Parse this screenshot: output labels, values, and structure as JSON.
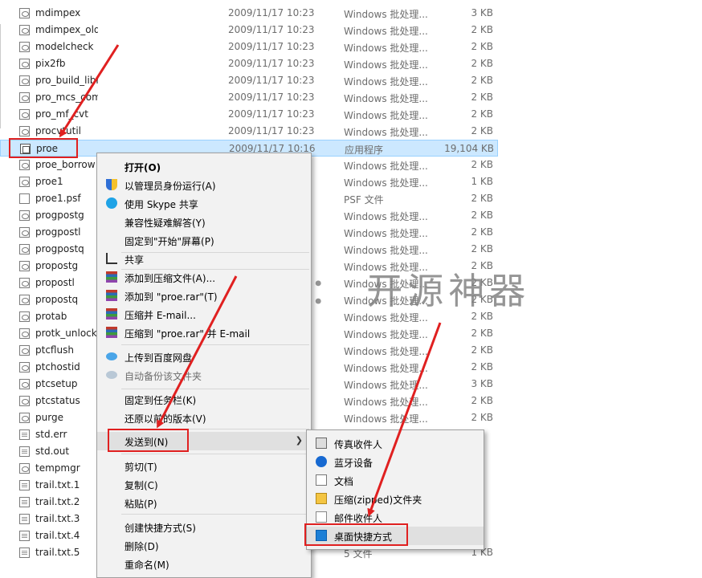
{
  "files": [
    {
      "name": "mdimpex",
      "date": "2009/11/17 10:23",
      "type": "Windows 批处理...",
      "size": "3 KB",
      "icon": "batch-file-icon"
    },
    {
      "name": "mdimpex_old",
      "date": "2009/11/17 10:23",
      "type": "Windows 批处理...",
      "size": "2 KB",
      "icon": "batch-file-icon"
    },
    {
      "name": "modelcheck",
      "date": "2009/11/17 10:23",
      "type": "Windows 批处理...",
      "size": "2 KB",
      "icon": "batch-file-icon"
    },
    {
      "name": "pix2fb",
      "date": "2009/11/17 10:23",
      "type": "Windows 批处理...",
      "size": "2 KB",
      "icon": "batch-file-icon"
    },
    {
      "name": "pro_build_library_ctg",
      "date": "2009/11/17 10:23",
      "type": "Windows 批处理...",
      "size": "2 KB",
      "icon": "batch-file-icon"
    },
    {
      "name": "pro_mcs_comp",
      "date": "2009/11/17 10:23",
      "type": "Windows 批处理...",
      "size": "2 KB",
      "icon": "batch-file-icon"
    },
    {
      "name": "pro_mf_cvt",
      "date": "2009/11/17 10:23",
      "type": "Windows 批处理...",
      "size": "2 KB",
      "icon": "batch-file-icon"
    },
    {
      "name": "procvtutil",
      "date": "2009/11/17 10:23",
      "type": "Windows 批处理...",
      "size": "2 KB",
      "icon": "batch-file-icon"
    },
    {
      "name": "proe",
      "date": "2009/11/17 10:16",
      "type": "应用程序",
      "size": "19,104 KB",
      "icon": "application-icon"
    },
    {
      "name": "proe_borrow",
      "date": "",
      "type": "Windows 批处理...",
      "size": "2 KB",
      "icon": "batch-file-icon"
    },
    {
      "name": "proe1",
      "date": "",
      "type": "Windows 批处理...",
      "size": "1 KB",
      "icon": "batch-file-icon"
    },
    {
      "name": "proe1.psf",
      "date": "",
      "type": "PSF 文件",
      "size": "2 KB",
      "icon": "generic-file-icon"
    },
    {
      "name": "progpostg",
      "date": "",
      "type": "Windows 批处理...",
      "size": "2 KB",
      "icon": "batch-file-icon"
    },
    {
      "name": "progpostl",
      "date": "",
      "type": "Windows 批处理...",
      "size": "2 KB",
      "icon": "batch-file-icon"
    },
    {
      "name": "progpostq",
      "date": "",
      "type": "Windows 批处理...",
      "size": "2 KB",
      "icon": "batch-file-icon"
    },
    {
      "name": "propostg",
      "date": "",
      "type": "Windows 批处理...",
      "size": "2 KB",
      "icon": "batch-file-icon"
    },
    {
      "name": "propostl",
      "date": "",
      "type": "Windows 批处理...",
      "size": "2 KB",
      "icon": "batch-file-icon"
    },
    {
      "name": "propostq",
      "date": "",
      "type": "Windows 批处理...",
      "size": "2 KB",
      "icon": "batch-file-icon"
    },
    {
      "name": "protab",
      "date": "",
      "type": "Windows 批处理...",
      "size": "2 KB",
      "icon": "batch-file-icon"
    },
    {
      "name": "protk_unlock",
      "date": "",
      "type": "Windows 批处理...",
      "size": "2 KB",
      "icon": "batch-file-icon"
    },
    {
      "name": "ptcflush",
      "date": "",
      "type": "Windows 批处理...",
      "size": "2 KB",
      "icon": "batch-file-icon"
    },
    {
      "name": "ptchostid",
      "date": "",
      "type": "Windows 批处理...",
      "size": "2 KB",
      "icon": "batch-file-icon"
    },
    {
      "name": "ptcsetup",
      "date": "",
      "type": "Windows 批处理...",
      "size": "3 KB",
      "icon": "batch-file-icon"
    },
    {
      "name": "ptcstatus",
      "date": "",
      "type": "Windows 批处理...",
      "size": "2 KB",
      "icon": "batch-file-icon"
    },
    {
      "name": "purge",
      "date": "",
      "type": "Windows 批处理...",
      "size": "2 KB",
      "icon": "batch-file-icon"
    },
    {
      "name": "std.err",
      "date": "",
      "type": "",
      "size": "",
      "icon": "text-file-icon"
    },
    {
      "name": "std.out",
      "date": "",
      "type": "",
      "size": "",
      "icon": "text-file-icon"
    },
    {
      "name": "tempmgr",
      "date": "",
      "type": "",
      "size": "",
      "icon": "batch-file-icon"
    },
    {
      "name": "trail.txt.1",
      "date": "",
      "type": "",
      "size": "",
      "icon": "text-file-icon"
    },
    {
      "name": "trail.txt.2",
      "date": "",
      "type": "",
      "size": "",
      "icon": "text-file-icon"
    },
    {
      "name": "trail.txt.3",
      "date": "",
      "type": "",
      "size": "",
      "icon": "text-file-icon"
    },
    {
      "name": "trail.txt.4",
      "date": "",
      "type": "",
      "size": "",
      "icon": "text-file-icon"
    },
    {
      "name": "trail.txt.5",
      "date": "",
      "type": "5 文件",
      "size": "1 KB",
      "icon": "text-file-icon"
    }
  ],
  "selected_file": "proe",
  "context_menu": {
    "open": "打开(O)",
    "run_as_admin": "以管理员身份运行(A)",
    "skype_share": "使用 Skype 共享",
    "compat_troubleshoot": "兼容性疑难解答(Y)",
    "pin_start": "固定到\"开始\"屏幕(P)",
    "share": "共享",
    "add_to_archive": "添加到压缩文件(A)...",
    "add_to_proe_rar": "添加到 \"proe.rar\"(T)",
    "compress_email": "压缩并 E-mail...",
    "compress_proe_rar_email": "压缩到 \"proe.rar\" 并 E-mail",
    "upload_baidu": "上传到百度网盘",
    "auto_backup": "自动备份该文件夹",
    "pin_taskbar": "固定到任务栏(K)",
    "restore_versions": "还原以前的版本(V)",
    "send_to": "发送到(N)",
    "cut": "剪切(T)",
    "copy": "复制(C)",
    "paste": "粘贴(P)",
    "create_shortcut": "创建快捷方式(S)",
    "delete": "删除(D)",
    "rename": "重命名(M)"
  },
  "sendto_menu": {
    "fax": "传真收件人",
    "bluetooth": "蓝牙设备",
    "documents": "文档",
    "zip_folder": "压缩(zipped)文件夹",
    "mail_recipient": "邮件收件人",
    "desktop_shortcut": "桌面快捷方式"
  },
  "watermark": "公众号： 开源神器",
  "colors": {
    "selection": "#cce8ff",
    "annotation": "#e02020"
  }
}
